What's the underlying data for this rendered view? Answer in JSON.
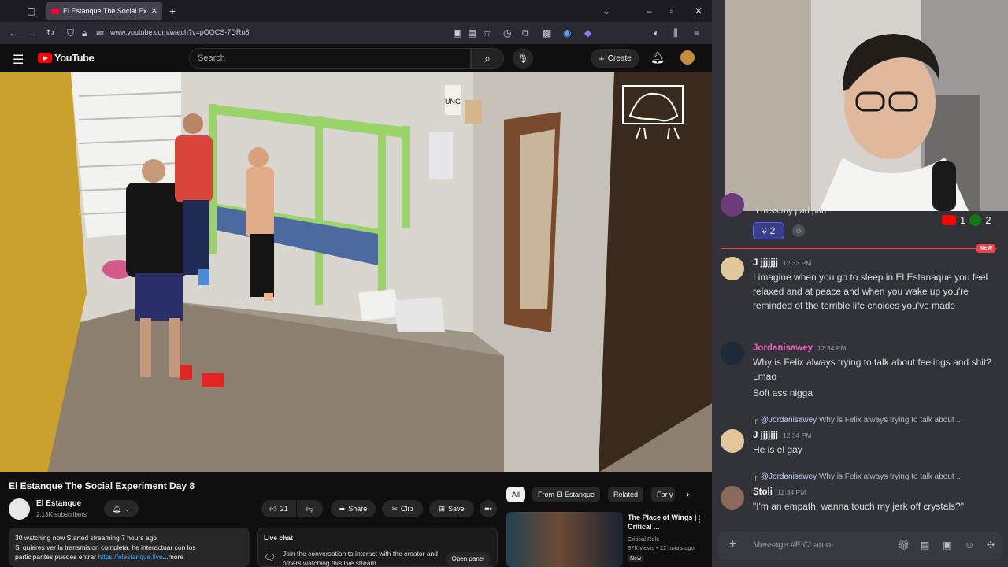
{
  "browser": {
    "tab_title": "El Estanque The Social Expe",
    "url": "www.youtube.com/watch?v=pOOCS-7DRu8"
  },
  "youtube": {
    "logo_text": "YouTube",
    "search_placeholder": "Search",
    "create_label": "Create",
    "video_title": "El Estanque The Social Experiment Day 8",
    "video_overlay_sign": "UNG",
    "channel_name": "El Estanque",
    "subscribers": "2.13K subscribers",
    "like_count": "21",
    "share_label": "Share",
    "clip_label": "Clip",
    "save_label": "Save",
    "description": {
      "stats": "30 watching now  Started streaming 7 hours ago",
      "line1": "Si quieres ver la transmision completa, he interactuar con los",
      "line2_prefix": "participantes puedes entrar ",
      "link": "https://elestanque.live",
      "more": "...more"
    },
    "live_chat": {
      "title": "Live chat",
      "text": "Join the conversation to interact with the creator and others watching this live stream.",
      "open_panel": "Open panel"
    },
    "chips": [
      "All",
      "From El Estanque",
      "Related",
      "For y"
    ],
    "recommendation": {
      "title": "The Place of Wings | Critical ...",
      "channel": "Critical Role",
      "meta": "97K views • 22 hours ago",
      "badge": "New"
    }
  },
  "discord": {
    "cut_message": "I miss my pad pad",
    "reaction_count": "2",
    "youtube_count": "1",
    "xbox_count": "2",
    "new_tag": "NEW",
    "messages": [
      {
        "user": "J jjjjjjj",
        "time": "12:33 PM",
        "lines": [
          "I imagine when you go to sleep in El Estanaque you feel relaxed and at peace and when you wake up you're reminded of the terrible life choices you've made"
        ]
      },
      {
        "user": "Jordanisawey",
        "time": "12:34 PM",
        "lines": [
          "Why is Felix always trying to talk about feelings and shit? Lmao",
          "Soft ass nigga"
        ]
      },
      {
        "user": "J jjjjjjj",
        "time": "12:34 PM",
        "reply_mention": "@Jordanisawey",
        "reply_text": "Why is Felix always trying to talk about ...",
        "lines": [
          "He is el gay"
        ]
      },
      {
        "user": "Stoli",
        "time": "12:34 PM",
        "reply_mention": "@Jordanisawey",
        "reply_text": "Why is Felix always trying to talk about ...",
        "lines": [
          "\"I'm an empath, wanna touch my jerk off crystals?\""
        ]
      }
    ],
    "composer_placeholder": "Message #ElCharco-"
  }
}
